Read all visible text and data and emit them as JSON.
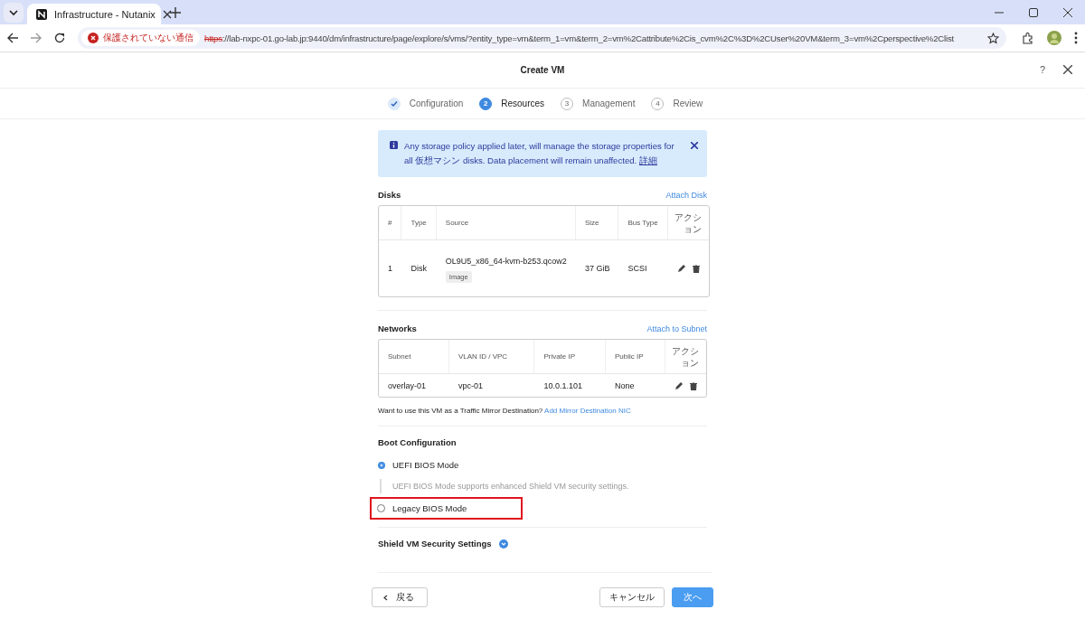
{
  "browser": {
    "tab_title": "Infrastructure - Nutanix",
    "security_label": "保護されていない通信",
    "url_scheme": "https",
    "url_rest": "://lab-nxpc-01.go-lab.jp:9440/dm/infrastructure/page/explore/s/vms/?entity_type=vm&term_1=vm&term_2=vm%2Cattribute%2Cis_cvm%2C%3D%2CUser%20VM&term_3=vm%2Cperspective%2Clist"
  },
  "modal": {
    "title": "Create VM",
    "help": "?",
    "steps": [
      {
        "label": "Configuration",
        "completed": true,
        "selected": false
      },
      {
        "number": "2",
        "label": "Resources",
        "completed": false,
        "selected": true
      },
      {
        "number": "3",
        "label": "Management",
        "completed": false,
        "selected": false
      },
      {
        "number": "4",
        "label": "Review",
        "completed": false,
        "selected": false
      }
    ],
    "banner": {
      "text": "Any storage policy applied later, will manage the storage properties for all 仮想マシン disks. Data placement will remain unaffected.",
      "link": "詳細"
    },
    "disks": {
      "title": "Disks",
      "action": "Attach Disk",
      "columns": [
        "#",
        "Type",
        "Source",
        "Size",
        "Bus Type",
        "アクション"
      ],
      "rows": [
        {
          "cells": [
            "1",
            "Disk",
            "OL9U5_x86_64-kvm-b253.qcow2",
            "37 GiB",
            "SCSI"
          ],
          "source_tag": "Image"
        }
      ]
    },
    "networks": {
      "title": "Networks",
      "action": "Attach to Subnet",
      "columns": [
        "Subnet",
        "VLAN ID / VPC",
        "Private IP",
        "Public IP",
        "アクション"
      ],
      "rows": [
        {
          "cells": [
            "overlay-01",
            "vpc-01",
            "10.0.1.101",
            "None"
          ]
        }
      ]
    },
    "mirror": {
      "question": "Want to use this VM as a Traffic Mirror Destination?",
      "link": "Add Mirror Destination NIC"
    },
    "boot": {
      "title": "Boot Configuration",
      "options": [
        {
          "label": "UEFI BIOS Mode",
          "selected": true,
          "highlighted": false,
          "hint": "UEFI BIOS Mode supports enhanced Shield VM security settings."
        },
        {
          "label": "Legacy BIOS Mode",
          "selected": false,
          "highlighted": true
        }
      ]
    },
    "shield": {
      "title": "Shield VM Security Settings"
    },
    "footer": {
      "back": "戻る",
      "cancel": "キャンセル",
      "next": "次へ"
    }
  }
}
